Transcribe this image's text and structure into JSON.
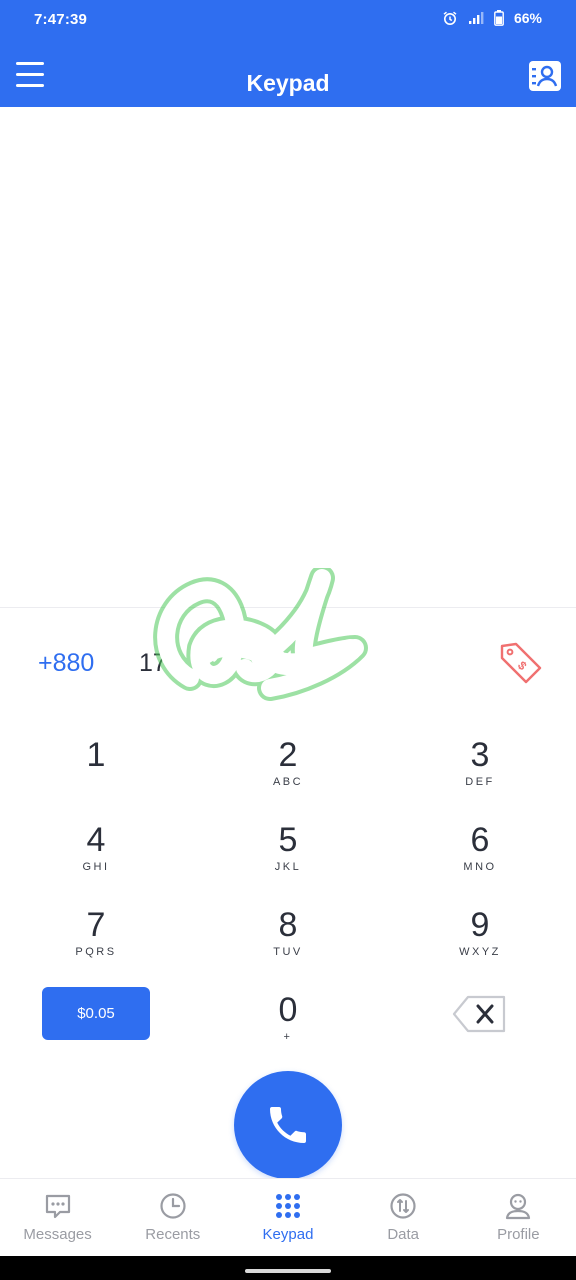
{
  "status_bar": {
    "time": "7:47:39",
    "battery": "66%",
    "icons": [
      "alarm-icon",
      "signal-icon",
      "battery-icon"
    ]
  },
  "header": {
    "title": "Keypad",
    "menu_icon": "menu-icon",
    "contacts_icon": "contacts-icon"
  },
  "dialer": {
    "country_code": "+880",
    "number_visible": "17",
    "rate_icon": "price-tag-icon"
  },
  "keys": [
    {
      "digit": "1",
      "letters": ""
    },
    {
      "digit": "2",
      "letters": "ABC"
    },
    {
      "digit": "3",
      "letters": "DEF"
    },
    {
      "digit": "4",
      "letters": "GHI"
    },
    {
      "digit": "5",
      "letters": "JKL"
    },
    {
      "digit": "6",
      "letters": "MNO"
    },
    {
      "digit": "7",
      "letters": "PQRS"
    },
    {
      "digit": "8",
      "letters": "TUV"
    },
    {
      "digit": "9",
      "letters": "WXYZ"
    },
    {
      "digit": "0",
      "letters": "+"
    }
  ],
  "credit": {
    "label": "$0.05"
  },
  "bottom_nav": [
    {
      "label": "Messages",
      "icon": "messages-icon",
      "active": false
    },
    {
      "label": "Recents",
      "icon": "clock-icon",
      "active": false
    },
    {
      "label": "Keypad",
      "icon": "keypad-grid-icon",
      "active": true
    },
    {
      "label": "Data",
      "icon": "data-icon",
      "active": false
    },
    {
      "label": "Profile",
      "icon": "profile-icon",
      "active": false
    }
  ],
  "colors": {
    "accent": "#2f6ef0",
    "text": "#2b2f3a",
    "inactive": "#9a9ca3",
    "tag": "#f07070",
    "scribble": "#4cc85a"
  }
}
